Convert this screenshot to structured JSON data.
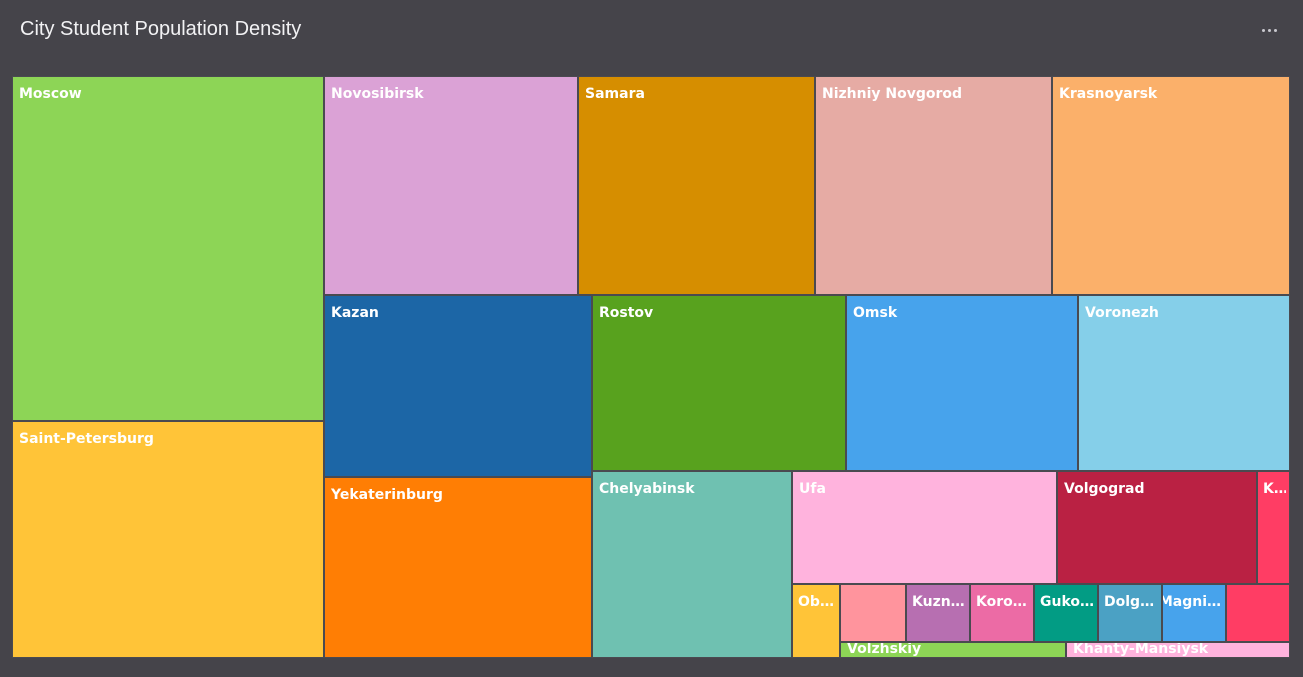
{
  "header": {
    "title": "City Student Population Density",
    "menu_icon": "more-horizontal-icon"
  },
  "chart_data": {
    "type": "treemap",
    "title": "City Student Population Density",
    "items": [
      {
        "name": "Moscow",
        "label": "Moscow",
        "color": "#8dd556"
      },
      {
        "name": "Saint-Petersburg",
        "label": "Saint-Petersburg",
        "color": "#ffc438"
      },
      {
        "name": "Novosibirsk",
        "label": "Novosibirsk",
        "color": "#dba2d6"
      },
      {
        "name": "Samara",
        "label": "Samara",
        "color": "#d68e00"
      },
      {
        "name": "Nizhniy Novgorod",
        "label": "Nizhniy Novgorod",
        "color": "#e6aba4"
      },
      {
        "name": "Krasnoyarsk",
        "label": "Krasnoyarsk",
        "color": "#fbb06a"
      },
      {
        "name": "Kazan",
        "label": "Kazan",
        "color": "#1c66a6"
      },
      {
        "name": "Yekaterinburg",
        "label": "Yekaterinburg",
        "color": "#ff7e04"
      },
      {
        "name": "Rostov",
        "label": "Rostov",
        "color": "#58a21e"
      },
      {
        "name": "Omsk",
        "label": "Omsk",
        "color": "#47a3ec"
      },
      {
        "name": "Voronezh",
        "label": "Voronezh",
        "color": "#85cfe9"
      },
      {
        "name": "Chelyabinsk",
        "label": "Chelyabinsk",
        "color": "#6fc1b1"
      },
      {
        "name": "Ufa",
        "label": "Ufa",
        "color": "#ffb3dd"
      },
      {
        "name": "Volgograd",
        "label": "Volgograd",
        "color": "#ba2143"
      },
      {
        "name": "K…",
        "label": "K…",
        "color": "#ff3d64"
      },
      {
        "name": "Obn…",
        "label": "Obn…",
        "color": "#ffc438"
      },
      {
        "name": "",
        "label": "",
        "color": "#ff949d"
      },
      {
        "name": "Kuzn…",
        "label": "Kuzn…",
        "color": "#b76fb1"
      },
      {
        "name": "Korol…",
        "label": "Korol…",
        "color": "#ec6ba5"
      },
      {
        "name": "Guko…",
        "label": "Guko…",
        "color": "#029c84"
      },
      {
        "name": "Dolgo…",
        "label": "Dolgo…",
        "color": "#4ba1c4"
      },
      {
        "name": "Magni…",
        "label": "Magni…",
        "color": "#47a3ec"
      },
      {
        "name": "",
        "label": "",
        "color": "#ff3d64"
      },
      {
        "name": "Volzhskiy",
        "label": "Volzhskiy",
        "color": "#8dd556"
      },
      {
        "name": "Khanty-Mansiysk",
        "label": "Khanty-Mansiysk",
        "color": "#ffb3dd"
      }
    ]
  }
}
